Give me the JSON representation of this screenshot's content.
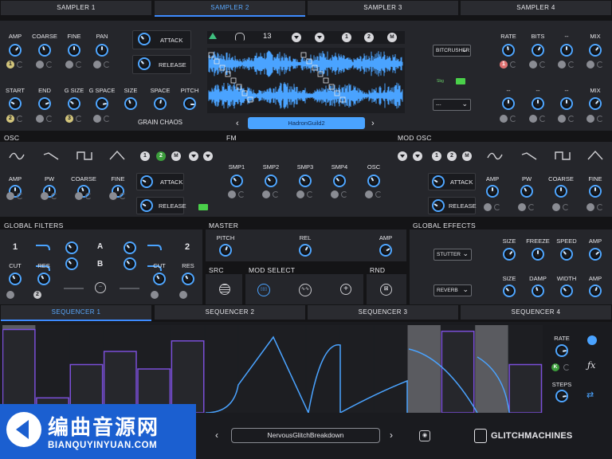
{
  "sampler_tabs": [
    "SAMPLER 1",
    "SAMPLER 2",
    "SAMPLER 3",
    "SAMPLER 4"
  ],
  "active_sampler_tab": 1,
  "sampler": {
    "row1_labels": [
      "AMP",
      "COARSE",
      "FINE",
      "PAN"
    ],
    "row2_labels": [
      "START",
      "END",
      "G SIZE",
      "G SPACE"
    ],
    "grain_labels": [
      "SIZE",
      "SPACE",
      "PITCH"
    ],
    "grain_chaos": "GRAIN CHAOS",
    "attack": "ATTACK",
    "release": "RELEASE",
    "slice_count": "13",
    "toggle_one": "1",
    "toggle_two": "2",
    "sample_name": "HadronGuild2",
    "nav_prev": "‹",
    "nav_next": "›",
    "badge_one": "1",
    "badge_two": "2",
    "badge_three": "3",
    "small_tag": "Sbg"
  },
  "right_fx": {
    "select1": "BITCRUSHER",
    "select2": "---",
    "row1_labels": [
      "RATE",
      "BITS",
      "--",
      "MIX"
    ],
    "row2_labels": [
      "--",
      "--",
      "--",
      "MIX"
    ],
    "badge": "1"
  },
  "sections": {
    "osc": "OSC",
    "fm": "FM",
    "mod_osc": "MOD OSC",
    "global_filters": "GLOBAL FILTERS",
    "master": "MASTER",
    "global_effects": "GLOBAL EFFECTS",
    "src": "SRC",
    "mod_select": "MOD SELECT",
    "rnd": "RND"
  },
  "osc": {
    "labels": [
      "AMP",
      "PW",
      "COARSE",
      "FINE"
    ],
    "attack": "ATTACK",
    "release": "RELEASE",
    "toggle_one": "1",
    "toggle_two": "2"
  },
  "fm": {
    "labels": [
      "SMP1",
      "SMP2",
      "SMP3",
      "SMP4",
      "OSC"
    ]
  },
  "mod_osc": {
    "labels": [
      "AMP",
      "PW",
      "COARSE",
      "FINE"
    ],
    "attack": "ATTACK",
    "release": "RELEASE",
    "toggle_one": "1",
    "toggle_two": "2"
  },
  "filters": {
    "num1": "1",
    "num2": "2",
    "a": "A",
    "b": "B",
    "cut1": "CUT",
    "res1": "RES",
    "cut2": "CUT",
    "res2": "RES",
    "badge": "2"
  },
  "master": {
    "labels": [
      "PITCH",
      "REL",
      "AMP"
    ]
  },
  "global_effects": {
    "select1": "STUTTER",
    "select2": "REVERB",
    "row1_labels": [
      "SIZE",
      "FREEZE",
      "SPEED",
      "AMP"
    ],
    "row2_labels": [
      "SIZE",
      "DAMP",
      "WIDTH",
      "AMP"
    ]
  },
  "sequencer_tabs": [
    "SEQUENCER 1",
    "SEQUENCER 2",
    "SEQUENCER 3",
    "SEQUENCER 4"
  ],
  "active_sequencer_tab": 0,
  "sequencer_side": {
    "rate": "RATE",
    "steps": "STEPS",
    "k_badge": "K"
  },
  "sequencer_steps": [
    0.95,
    0.17,
    0.55,
    0.7,
    0.5,
    0.82,
    0,
    0,
    0,
    0,
    0,
    0,
    0,
    0.93,
    0,
    0.55
  ],
  "preset": {
    "name": "NervousGlitchBreakdown",
    "prev": "‹",
    "next": "›"
  },
  "brand": "GLITCHMACHINES",
  "watermark": {
    "title": "编曲音源网",
    "url": "BIANQUYINYUAN.COM"
  },
  "colors": {
    "accent": "#3d8bff",
    "panel": "#25262b",
    "background": "#141416",
    "purple": "#7a4fd8",
    "green": "#4ad04a"
  }
}
